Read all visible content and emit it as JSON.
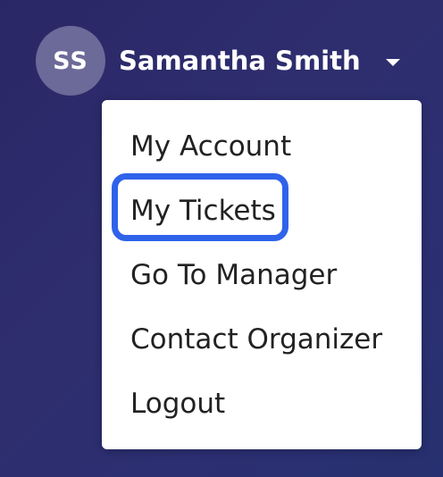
{
  "user": {
    "initials": "SS",
    "name": "Samantha Smith",
    "avatar_color": "#6b6a98"
  },
  "menu": {
    "items": [
      {
        "label": "My Account"
      },
      {
        "label": "My Tickets",
        "focused": true
      },
      {
        "label": "Go To Manager"
      },
      {
        "label": "Contact Organizer"
      },
      {
        "label": "Logout"
      }
    ]
  },
  "colors": {
    "background": "#2d2c6d",
    "focus_ring": "#2f63ea",
    "menu_text": "#222222"
  },
  "icons": {
    "dropdown": "caret-down-icon"
  }
}
